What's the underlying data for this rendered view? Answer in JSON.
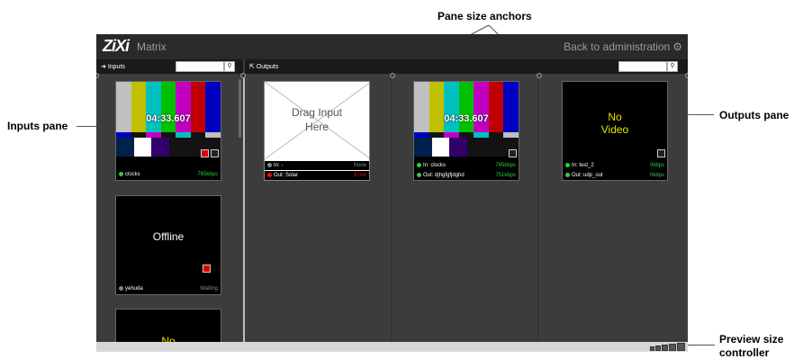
{
  "annotations": {
    "pane_size_anchors": "Pane size anchors",
    "inputs_pane": "Inputs pane",
    "outputs_pane": "Outputs pane",
    "preview_size_controller_line1": "Preview size",
    "preview_size_controller_line2": "controller"
  },
  "app": {
    "logo": "ZiXi",
    "title": "Matrix",
    "back_link": "Back to administration",
    "back_icon": "gear-icon"
  },
  "inputs": {
    "header": "Inputs",
    "header_icon": "sign-in-icon",
    "search_icon": "search-icon",
    "items": [
      {
        "timecode": "04:33.607",
        "name": "clocks",
        "rate": "765kbps",
        "status_color": "#2ecc40"
      },
      {
        "overlay": "Offline",
        "name": "yehuda",
        "rate": "Waiting",
        "status_color": "#888888"
      },
      {
        "overlay": "No"
      }
    ]
  },
  "outputs": {
    "header": "Outputs",
    "header_icon": "external-link-icon",
    "search_icon": "search-icon",
    "items": [
      {
        "drag_text_line1": "Drag Input",
        "drag_text_line2": "Here",
        "in_label": "In: -",
        "in_value": "None",
        "out_label": "Out: Solar",
        "out_value": "Error"
      },
      {
        "timecode": "04:33.607",
        "in_label": "In: clocks",
        "in_value": "765kbps",
        "out_label": "Out: djhgfgfjdghd",
        "out_value": "751kbps"
      },
      {
        "novideo_line1": "No",
        "novideo_line2": "Video",
        "in_label": "In: test_2",
        "in_value": "0kbps",
        "out_label": "Out: udp_out",
        "out_value": "0kbps"
      }
    ]
  },
  "colors": {
    "accent_green": "#2ecc40",
    "error_red": "#e01010",
    "novideo_yellow": "#e8e000"
  }
}
